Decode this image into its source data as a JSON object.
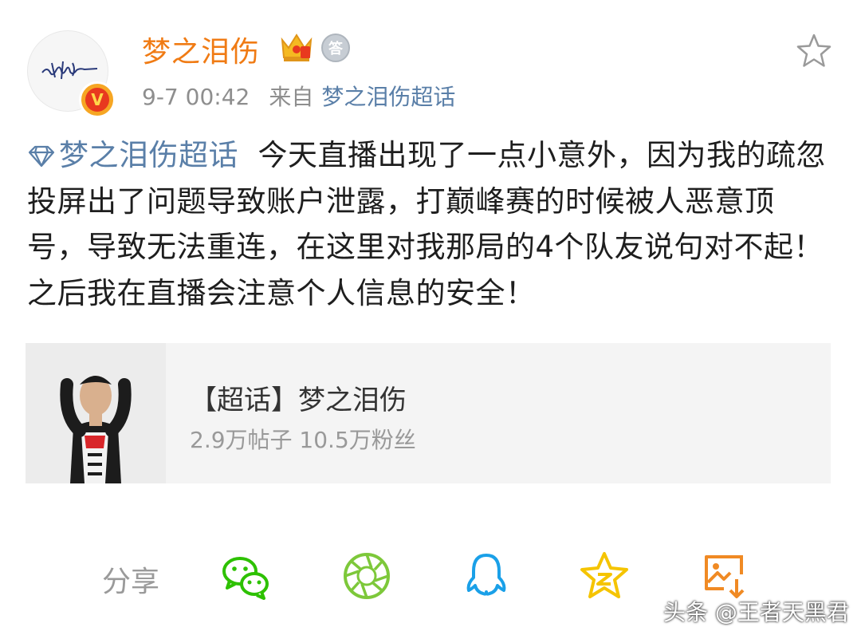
{
  "post": {
    "username": "梦之泪伤",
    "timestamp": "9-7 00:42",
    "source_prefix": "来自",
    "source": "梦之泪伤超话",
    "medal_char": "答",
    "vip_char": "V",
    "topic": "梦之泪伤超话",
    "text": "今天直播出现了一点小意外，因为我的疏忽投屏出了问题导致账户泄露，打巅峰赛的时候被人恶意顶号，导致无法重连，在这里对我那局的4个队友说句对不起！之后我在直播会注意个人信息的安全！"
  },
  "card": {
    "title": "【超话】梦之泪伤",
    "subtitle": "2.9万帖子 10.5万粉丝"
  },
  "share": {
    "label": "分享",
    "targets": [
      "wechat-icon",
      "moments-icon",
      "qq-icon",
      "qzone-icon",
      "save-image-icon"
    ]
  },
  "watermark": "头条 @王者天黑君",
  "colors": {
    "username": "#f07b14",
    "link": "#5a7fa8",
    "meta": "#8e8e8e",
    "wechat": "#2dc100",
    "moments": "#7dc83a",
    "qq": "#1aa0e8",
    "qzone": "#f5c400",
    "save": "#f08a24"
  }
}
